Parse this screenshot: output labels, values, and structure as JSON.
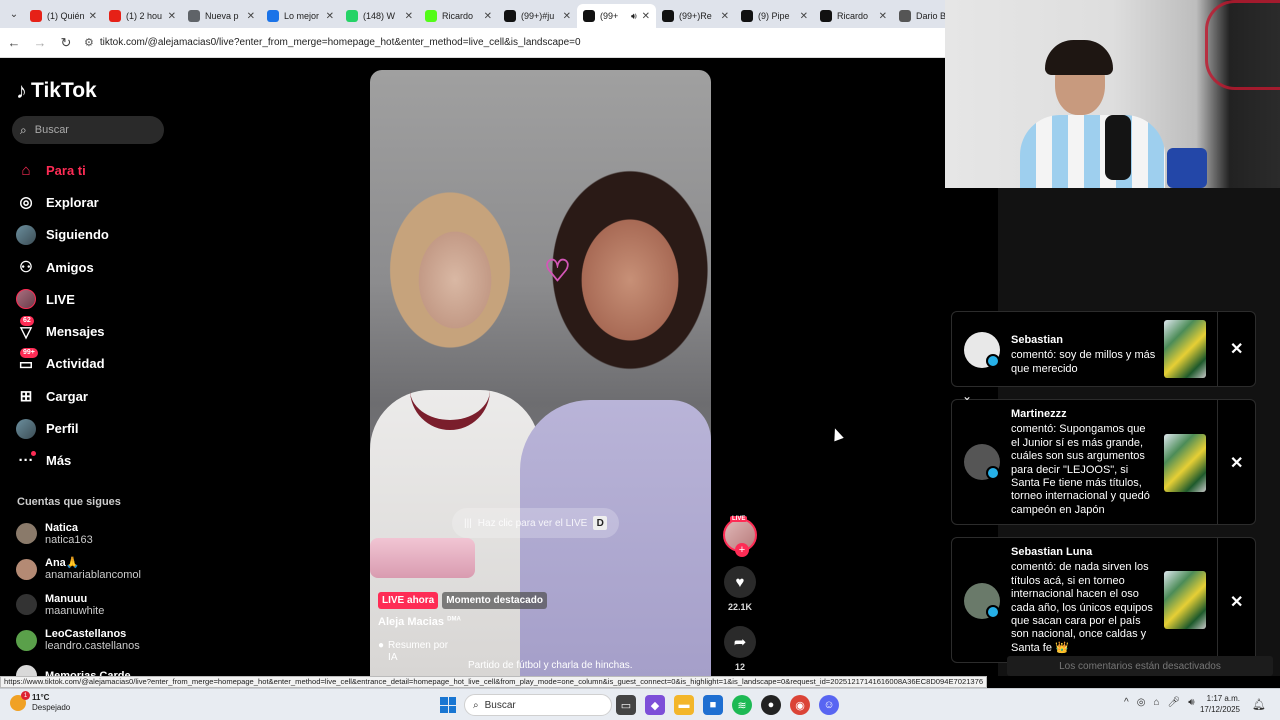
{
  "browser": {
    "tabs": [
      {
        "label": "(1) Quién",
        "icon": "youtube-icon",
        "color": "#e62117",
        "active": false
      },
      {
        "label": "(1) 2 hou",
        "icon": "youtube-icon",
        "color": "#e62117",
        "active": false
      },
      {
        "label": "Nueva p",
        "icon": "chrome-icon",
        "color": "#5f6368",
        "active": false
      },
      {
        "label": "Lo mejor",
        "icon": "dailymotion-icon",
        "color": "#1a73e8",
        "active": false
      },
      {
        "label": "(148) W",
        "icon": "whatsapp-icon",
        "color": "#25d366",
        "active": false
      },
      {
        "label": "Ricardo",
        "icon": "kick-icon",
        "color": "#53fc18",
        "active": false
      },
      {
        "label": "(99+)#ju",
        "icon": "tiktok-icon",
        "color": "#111111",
        "active": false
      },
      {
        "label": "(99+",
        "icon": "tiktok-icon",
        "color": "#111111",
        "active": true
      },
      {
        "label": "(99+)Re",
        "icon": "tiktok-icon",
        "color": "#111111",
        "active": false
      },
      {
        "label": "(9) Pipe",
        "icon": "x-icon",
        "color": "#111111",
        "active": false
      },
      {
        "label": "Ricardo",
        "icon": "tiktok-icon",
        "color": "#111111",
        "active": false
      },
      {
        "label": "Dario B",
        "icon": "wikipedia-icon",
        "color": "#555555",
        "active": false
      }
    ],
    "url": "tiktok.com/@alejamacias0/live?enter_from_merge=homepage_hot&enter_method=live_cell&is_landscape=0",
    "status_url": "https://www.tiktok.com/@alejamacias0/live?enter_from_merge=homepage_hot&enter_method=live_cell&entrance_detail=homepage_hot_live_cell&from_play_mode=one_column&is_guest_connect=0&is_highlight=1&is_landscape=0&request_id=20251217141616008A36EC8D094E7021376"
  },
  "sidebar": {
    "logo": "TikTok",
    "search_placeholder": "Buscar",
    "nav": [
      {
        "label": "Para ti",
        "icon": "home-icon",
        "active": true
      },
      {
        "label": "Explorar",
        "icon": "compass-icon"
      },
      {
        "label": "Siguiendo",
        "icon": "following-avatar-icon"
      },
      {
        "label": "Amigos",
        "icon": "friends-icon"
      },
      {
        "label": "LIVE",
        "icon": "live-icon"
      },
      {
        "label": "Mensajes",
        "icon": "messages-icon",
        "badge": "62"
      },
      {
        "label": "Actividad",
        "icon": "activity-icon",
        "badge": "99+"
      },
      {
        "label": "Cargar",
        "icon": "upload-icon"
      },
      {
        "label": "Perfil",
        "icon": "profile-avatar-icon"
      },
      {
        "label": "Más",
        "icon": "more-icon"
      }
    ],
    "following_title": "Cuentas que sigues",
    "following": [
      {
        "name": "Natica",
        "user": "natica163",
        "color": "#8a7a6a"
      },
      {
        "name": "Ana🙏",
        "user": "anamariablancomol",
        "color": "#b48a74"
      },
      {
        "name": "Manuuu",
        "user": "maanuwhite",
        "color": "#333333"
      },
      {
        "name": "LeoCastellanos",
        "user": "leandro.castellanos",
        "color": "#5aa04a"
      },
      {
        "name": "Memorias Carde...",
        "user": "",
        "color": "#d9d9d9"
      }
    ]
  },
  "video": {
    "cta": "Haz clic para ver el LIVE",
    "cta_key": "D",
    "tag_live": "LIVE ahora",
    "tag_moment": "Momento destacado",
    "author": "Aleja Macias",
    "author_suffix": "DMA",
    "summary": "Resumen por IA",
    "description": "Partido de fútbol y charla de hinchas.",
    "live_badge": "LIVE",
    "likes": "22.1K",
    "shares": "12"
  },
  "notifications": [
    {
      "name": "Sebastian",
      "text": "comentó: soy de millos y más que merecido",
      "avatar_color": "#e8e8e8"
    },
    {
      "name": "Martinezzz",
      "text": "comentó: Supongamos que el Junior sí es más grande, cuáles son sus argumentos para decir \"LEJOOS\", si Santa Fe tiene más títulos, torneo internacional y quedó campeón en Japón",
      "avatar_color": "#555555"
    },
    {
      "name": "Sebastian Luna",
      "text": "comentó: de nada sirven los títulos acá, si en torneo internacional hacen el oso cada año, los únicos equipos que sacan cara por el país son nacional, once caldas y Santa fe 👑",
      "avatar_color": "#6a7a6a"
    }
  ],
  "comments_disabled": "Los comentarios están desactivados",
  "taskbar": {
    "temp": "11°C",
    "weather": "Despejado",
    "weather_badge": "1",
    "search": "Buscar",
    "time": "1:17 a.m.",
    "date": "17/12/2025"
  }
}
